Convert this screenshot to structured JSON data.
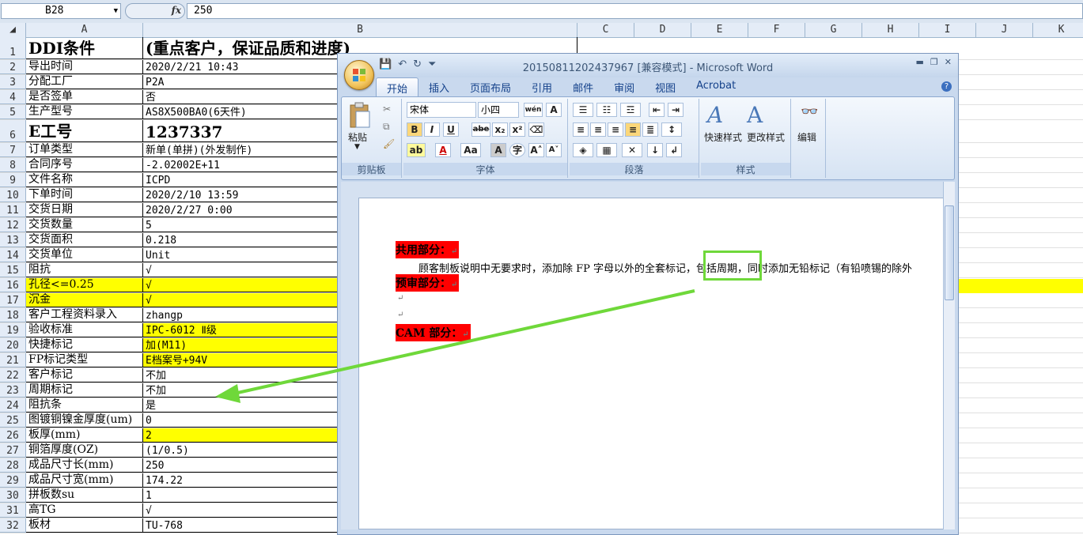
{
  "excel": {
    "name_box": "B28",
    "formula_value": "250",
    "columns": [
      "A",
      "B",
      "C",
      "D",
      "E",
      "F",
      "G",
      "H",
      "I",
      "J",
      "K"
    ],
    "rows": [
      {
        "n": "1",
        "a": "DDI条件",
        "b": "(重点客户，保证品质和进度)"
      },
      {
        "n": "2",
        "a": "导出时间",
        "b": "2020/2/21 10:43"
      },
      {
        "n": "3",
        "a": "分配工厂",
        "b": "P2A"
      },
      {
        "n": "4",
        "a": "是否签单",
        "b": "否"
      },
      {
        "n": "5",
        "a": "生产型号",
        "b": "AS8X500BA0(6天件)"
      },
      {
        "n": "6",
        "a": "E工号",
        "b": "1237337"
      },
      {
        "n": "7",
        "a": "订单类型",
        "b": "新单(单拼)(外发制作)"
      },
      {
        "n": "8",
        "a": "合同序号",
        "b": "-2.02002E+11"
      },
      {
        "n": "9",
        "a": "文件名称",
        "b": "ICPD"
      },
      {
        "n": "10",
        "a": "下单时间",
        "b": "2020/2/10 13:59"
      },
      {
        "n": "11",
        "a": "交货日期",
        "b": "2020/2/27 0:00"
      },
      {
        "n": "12",
        "a": "交货数量",
        "b": "5"
      },
      {
        "n": "13",
        "a": "交货面积",
        "b": "0.218"
      },
      {
        "n": "14",
        "a": "交货单位",
        "b": "Unit"
      },
      {
        "n": "15",
        "a": "阻抗",
        "b": "√"
      },
      {
        "n": "16",
        "a": "孔径<=0.25",
        "b": "√"
      },
      {
        "n": "17",
        "a": "沉金",
        "b": "√"
      },
      {
        "n": "18",
        "a": "客户工程资料录入",
        "b": "zhangp"
      },
      {
        "n": "19",
        "a": "验收标准",
        "b": "IPC-6012 Ⅱ级"
      },
      {
        "n": "20",
        "a": "快捷标记",
        "b": "加(M11)"
      },
      {
        "n": "21",
        "a": "FP标记类型",
        "b": "E档案号+94V"
      },
      {
        "n": "22",
        "a": "客户标记",
        "b": "不加"
      },
      {
        "n": "23",
        "a": "周期标记",
        "b": "不加"
      },
      {
        "n": "24",
        "a": "阻抗条",
        "b": "是"
      },
      {
        "n": "25",
        "a": "图镀铜镍金厚度(um)",
        "b": "0"
      },
      {
        "n": "26",
        "a": "板厚(mm)",
        "b": "2"
      },
      {
        "n": "27",
        "a": "铜箔厚度(OZ)",
        "b": "(1/0.5)"
      },
      {
        "n": "28",
        "a": "成品尺寸长(mm)",
        "b": "250"
      },
      {
        "n": "29",
        "a": "成品尺寸宽(mm)",
        "b": "174.22"
      },
      {
        "n": "30",
        "a": "拼板数su",
        "b": "1"
      },
      {
        "n": "31",
        "a": "高TG",
        "b": "√"
      },
      {
        "n": "32",
        "a": "板材",
        "b": "TU-768"
      }
    ]
  },
  "word": {
    "title": "20150811202437967 [兼容模式] - Microsoft Word",
    "tabs": [
      "开始",
      "插入",
      "页面布局",
      "引用",
      "邮件",
      "审阅",
      "视图",
      "Acrobat"
    ],
    "ribbon": {
      "paste": "粘贴",
      "clipboard": "剪贴板",
      "font_name": "宋体",
      "font_size": "小四",
      "font_group": "字体",
      "paragraph_group": "段落",
      "quick_styles": "快速样式",
      "change_styles": "更改样式",
      "styles_group": "样式",
      "editing": "编辑",
      "wen": "wén",
      "bold": "B",
      "italic": "I",
      "underline": "U",
      "strike": "abe",
      "sub": "x₂",
      "sup": "x²",
      "font_color": "A",
      "aa": "Aa",
      "grow": "A˄",
      "shrink": "A˅"
    },
    "doc": {
      "h1": "共用部分：",
      "p1": "顾客制板说明中无要求时，添加除 FP 字母以外的全套标记，包括周期，同时添加无铅标记（有铅喷锡的除外",
      "h2": "预审部分：",
      "h3": "CAM 部分："
    }
  },
  "colors": {
    "highlight": "#ffff00",
    "heading_bg": "#ff0000",
    "annotation": "#6fd83a"
  }
}
